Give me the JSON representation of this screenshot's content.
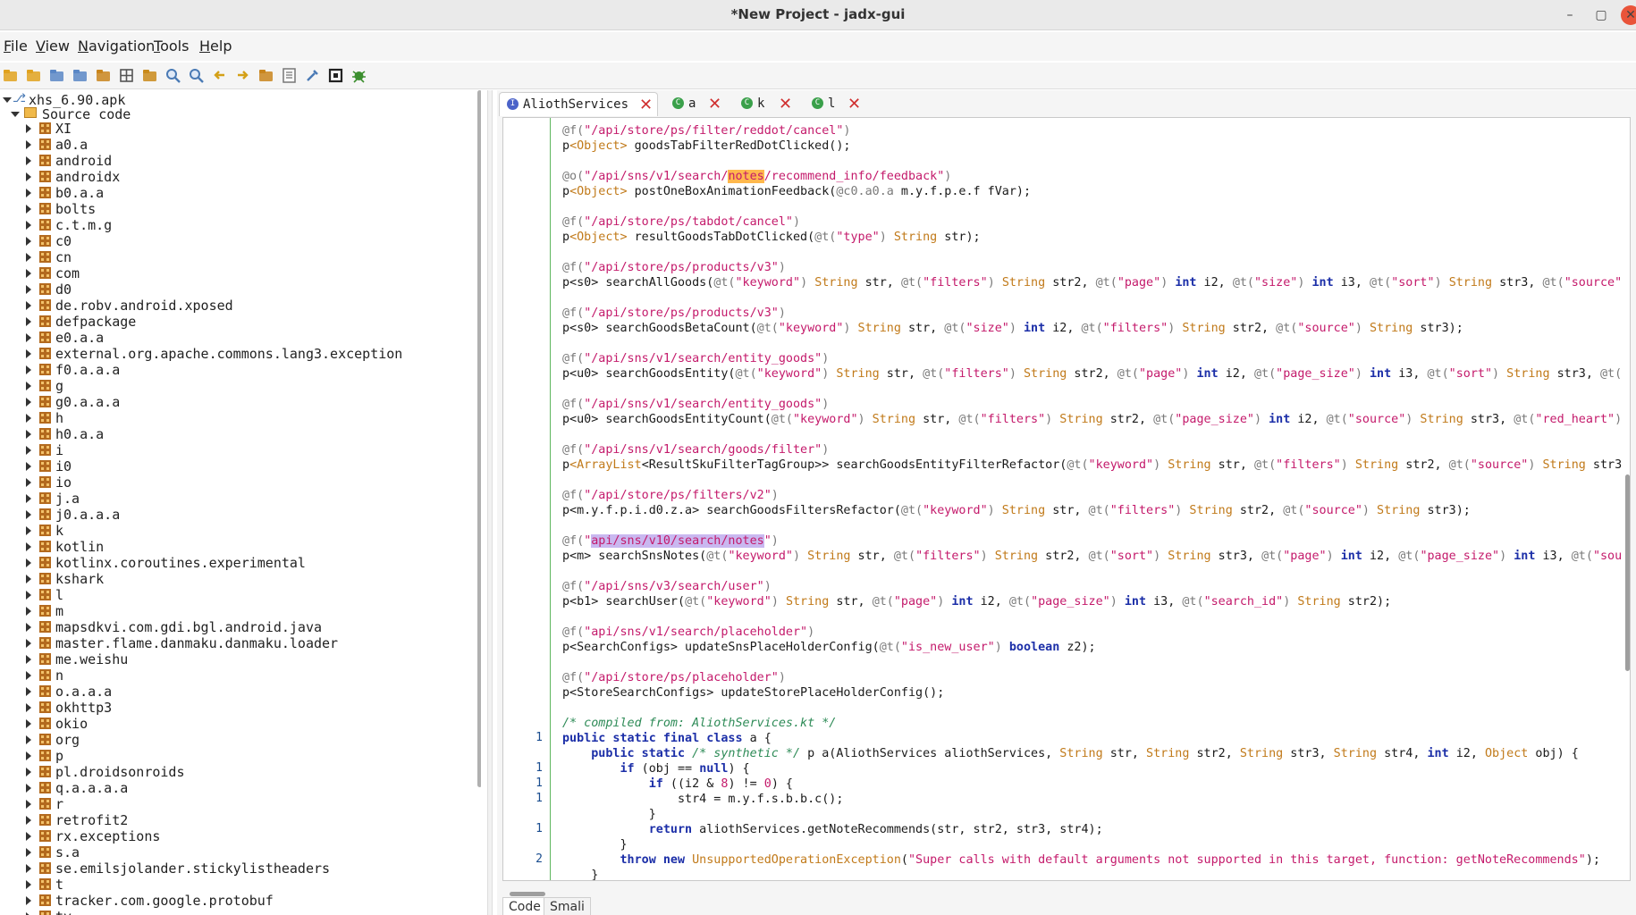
{
  "window": {
    "title": "*New Project - jadx-gui",
    "controls": [
      "–",
      "▢",
      "✕"
    ]
  },
  "menu": [
    {
      "label": "File",
      "mnemonic": "F",
      "rest": "ile"
    },
    {
      "label": "View",
      "mnemonic": "V",
      "rest": "iew"
    },
    {
      "label": "Navigation",
      "mnemonic": "N",
      "rest": "avigation"
    },
    {
      "label": "Tools",
      "mnemonic": "T",
      "rest": "ools"
    },
    {
      "label": "Help",
      "mnemonic": "H",
      "rest": "elp"
    }
  ],
  "toolbar": {
    "icons": [
      "open-file-icon",
      "add-files-icon",
      "save-all-icon",
      "export-icon",
      "sync-icon",
      "flatten-packages-icon",
      "decompile-icon",
      "search-icon",
      "search-class-icon",
      "back-icon",
      "forward-icon",
      "deobfuscation-icon",
      "log-viewer-icon",
      "preferences-icon",
      "quark-icon",
      "debug-icon"
    ]
  },
  "tree": {
    "root": "xhs_6.90.apk",
    "source_node": "Source code",
    "packages": [
      "XI",
      "a0.a",
      "android",
      "androidx",
      "b0.a.a",
      "bolts",
      "c.t.m.g",
      "c0",
      "cn",
      "com",
      "d0",
      "de.robv.android.xposed",
      "defpackage",
      "e0.a.a",
      "external.org.apache.commons.lang3.exception",
      "f0.a.a.a",
      "g",
      "g0.a.a.a",
      "h",
      "h0.a.a",
      "i",
      "i0",
      "io",
      "j.a",
      "j0.a.a.a",
      "k",
      "kotlin",
      "kotlinx.coroutines.experimental",
      "kshark",
      "l",
      "m",
      "mapsdkvi.com.gdi.bgl.android.java",
      "master.flame.danmaku.danmaku.loader",
      "me.weishu",
      "n",
      "o.a.a.a",
      "okhttp3",
      "okio",
      "org",
      "p",
      "pl.droidsonroids",
      "q.a.a.a.a",
      "r",
      "retrofit2",
      "rx.exceptions",
      "s.a",
      "se.emilsjolander.stickylistheaders",
      "t",
      "tracker.com.google.protobuf",
      "tv"
    ]
  },
  "tabs": [
    {
      "label": "AliothServices",
      "icon": "interface-icon",
      "active": true
    },
    {
      "label": "a",
      "icon": "class-icon",
      "active": false
    },
    {
      "label": "k",
      "icon": "class-icon",
      "active": false
    },
    {
      "label": "l",
      "icon": "class-icon",
      "active": false
    }
  ],
  "code_lines": [
    {
      "ln": "",
      "html": "<span class='ann'>@f(</span><span class='str'>\"/api/store/ps/filter/reddot/cancel\"</span><span class='ann'>)</span>"
    },
    {
      "ln": "",
      "html": "p<span class='typ'>&lt;Object&gt;</span> goodsTabFilterRedDotClicked();"
    },
    {
      "ln": "",
      "html": ""
    },
    {
      "ln": "",
      "html": "<span class='ann'>@o(</span><span class='str'>\"/api/sns/v1/search/<span class='hl-orange'>notes</span>/recommend_info/feedback\"</span><span class='ann'>)</span>"
    },
    {
      "ln": "",
      "html": "p<span class='typ'>&lt;Object&gt;</span> postOneBoxAnimationFeedback(<span class='ann'>@c0.a0.a</span> m.y.f.p.e.f fVar);"
    },
    {
      "ln": "",
      "html": ""
    },
    {
      "ln": "",
      "html": "<span class='ann'>@f(</span><span class='str'>\"/api/store/ps/tabdot/cancel\"</span><span class='ann'>)</span>"
    },
    {
      "ln": "",
      "html": "p<span class='typ'>&lt;Object&gt;</span> resultGoodsTabDotClicked(<span class='ann'>@t(</span><span class='str'>\"type\"</span><span class='ann'>)</span> <span class='typ'>String</span> str);"
    },
    {
      "ln": "",
      "html": ""
    },
    {
      "ln": "",
      "html": "<span class='ann'>@f(</span><span class='str'>\"/api/store/ps/products/v3\"</span><span class='ann'>)</span>"
    },
    {
      "ln": "",
      "html": "p&lt;s0&gt; searchAllGoods(<span class='ann'>@t(</span><span class='str'>\"keyword\"</span><span class='ann'>)</span> <span class='typ'>String</span> str, <span class='ann'>@t(</span><span class='str'>\"filters\"</span><span class='ann'>)</span> <span class='typ'>String</span> str2, <span class='ann'>@t(</span><span class='str'>\"page\"</span><span class='ann'>)</span> <span class='kw'>int</span> i2, <span class='ann'>@t(</span><span class='str'>\"size\"</span><span class='ann'>)</span> <span class='kw'>int</span> i3, <span class='ann'>@t(</span><span class='str'>\"sort\"</span><span class='ann'>)</span> <span class='typ'>String</span> str3, <span class='ann'>@t(</span><span class='str'>\"source\"</span>"
    },
    {
      "ln": "",
      "html": ""
    },
    {
      "ln": "",
      "html": "<span class='ann'>@f(</span><span class='str'>\"/api/store/ps/products/v3\"</span><span class='ann'>)</span>"
    },
    {
      "ln": "",
      "html": "p&lt;s0&gt; searchGoodsBetaCount(<span class='ann'>@t(</span><span class='str'>\"keyword\"</span><span class='ann'>)</span> <span class='typ'>String</span> str, <span class='ann'>@t(</span><span class='str'>\"size\"</span><span class='ann'>)</span> <span class='kw'>int</span> i2, <span class='ann'>@t(</span><span class='str'>\"filters\"</span><span class='ann'>)</span> <span class='typ'>String</span> str2, <span class='ann'>@t(</span><span class='str'>\"source\"</span><span class='ann'>)</span> <span class='typ'>String</span> str3);"
    },
    {
      "ln": "",
      "html": ""
    },
    {
      "ln": "",
      "html": "<span class='ann'>@f(</span><span class='str'>\"/api/sns/v1/search/entity_goods\"</span><span class='ann'>)</span>"
    },
    {
      "ln": "",
      "html": "p&lt;u0&gt; searchGoodsEntity(<span class='ann'>@t(</span><span class='str'>\"keyword\"</span><span class='ann'>)</span> <span class='typ'>String</span> str, <span class='ann'>@t(</span><span class='str'>\"filters\"</span><span class='ann'>)</span> <span class='typ'>String</span> str2, <span class='ann'>@t(</span><span class='str'>\"page\"</span><span class='ann'>)</span> <span class='kw'>int</span> i2, <span class='ann'>@t(</span><span class='str'>\"page_size\"</span><span class='ann'>)</span> <span class='kw'>int</span> i3, <span class='ann'>@t(</span><span class='str'>\"sort\"</span><span class='ann'>)</span> <span class='typ'>String</span> str3, <span class='ann'>@t(</span>"
    },
    {
      "ln": "",
      "html": ""
    },
    {
      "ln": "",
      "html": "<span class='ann'>@f(</span><span class='str'>\"/api/sns/v1/search/entity_goods\"</span><span class='ann'>)</span>"
    },
    {
      "ln": "",
      "html": "p&lt;u0&gt; searchGoodsEntityCount(<span class='ann'>@t(</span><span class='str'>\"keyword\"</span><span class='ann'>)</span> <span class='typ'>String</span> str, <span class='ann'>@t(</span><span class='str'>\"filters\"</span><span class='ann'>)</span> <span class='typ'>String</span> str2, <span class='ann'>@t(</span><span class='str'>\"page_size\"</span><span class='ann'>)</span> <span class='kw'>int</span> i2, <span class='ann'>@t(</span><span class='str'>\"source\"</span><span class='ann'>)</span> <span class='typ'>String</span> str3, <span class='ann'>@t(</span><span class='str'>\"red_heart\"</span><span class='ann'>)</span>"
    },
    {
      "ln": "",
      "html": ""
    },
    {
      "ln": "",
      "html": "<span class='ann'>@f(</span><span class='str'>\"/api/sns/v1/search/goods/filter\"</span><span class='ann'>)</span>"
    },
    {
      "ln": "",
      "html": "p<span class='typ'>&lt;ArrayList</span>&lt;ResultSkuFilterTagGroup&gt;&gt; searchGoodsEntityFilterRefactor(<span class='ann'>@t(</span><span class='str'>\"keyword\"</span><span class='ann'>)</span> <span class='typ'>String</span> str, <span class='ann'>@t(</span><span class='str'>\"filters\"</span><span class='ann'>)</span> <span class='typ'>String</span> str2, <span class='ann'>@t(</span><span class='str'>\"source\"</span><span class='ann'>)</span> <span class='typ'>String</span> str3"
    },
    {
      "ln": "",
      "html": ""
    },
    {
      "ln": "",
      "html": "<span class='ann'>@f(</span><span class='str'>\"/api/store/ps/filters/v2\"</span><span class='ann'>)</span>"
    },
    {
      "ln": "",
      "html": "p&lt;m.y.f.p.i.d0.z.a&gt; searchGoodsFiltersRefactor(<span class='ann'>@t(</span><span class='str'>\"keyword\"</span><span class='ann'>)</span> <span class='typ'>String</span> str, <span class='ann'>@t(</span><span class='str'>\"filters\"</span><span class='ann'>)</span> <span class='typ'>String</span> str2, <span class='ann'>@t(</span><span class='str'>\"source\"</span><span class='ann'>)</span> <span class='typ'>String</span> str3);"
    },
    {
      "ln": "",
      "html": ""
    },
    {
      "ln": "",
      "html": "<span class='ann'>@f(</span><span class='str'>\"<span class='hl-purple'>api/sns/v10/search/notes</span>\"</span><span class='ann'>)</span>"
    },
    {
      "ln": "",
      "html": "p&lt;m&gt; searchSnsNotes(<span class='ann'>@t(</span><span class='str'>\"keyword\"</span><span class='ann'>)</span> <span class='typ'>String</span> str, <span class='ann'>@t(</span><span class='str'>\"filters\"</span><span class='ann'>)</span> <span class='typ'>String</span> str2, <span class='ann'>@t(</span><span class='str'>\"sort\"</span><span class='ann'>)</span> <span class='typ'>String</span> str3, <span class='ann'>@t(</span><span class='str'>\"page\"</span><span class='ann'>)</span> <span class='kw'>int</span> i2, <span class='ann'>@t(</span><span class='str'>\"page_size\"</span><span class='ann'>)</span> <span class='kw'>int</span> i3, <span class='ann'>@t(</span><span class='str'>\"sou</span>"
    },
    {
      "ln": "",
      "html": ""
    },
    {
      "ln": "",
      "html": "<span class='ann'>@f(</span><span class='str'>\"/api/sns/v3/search/user\"</span><span class='ann'>)</span>"
    },
    {
      "ln": "",
      "html": "p&lt;b1&gt; searchUser(<span class='ann'>@t(</span><span class='str'>\"keyword\"</span><span class='ann'>)</span> <span class='typ'>String</span> str, <span class='ann'>@t(</span><span class='str'>\"page\"</span><span class='ann'>)</span> <span class='kw'>int</span> i2, <span class='ann'>@t(</span><span class='str'>\"page_size\"</span><span class='ann'>)</span> <span class='kw'>int</span> i3, <span class='ann'>@t(</span><span class='str'>\"search_id\"</span><span class='ann'>)</span> <span class='typ'>String</span> str2);"
    },
    {
      "ln": "",
      "html": ""
    },
    {
      "ln": "",
      "html": "<span class='ann'>@f(</span><span class='str'>\"api/sns/v1/search/placeholder\"</span><span class='ann'>)</span>"
    },
    {
      "ln": "",
      "html": "p&lt;SearchConfigs&gt; updateSnsPlaceHolderConfig(<span class='ann'>@t(</span><span class='str'>\"is_new_user\"</span><span class='ann'>)</span> <span class='kw'>boolean</span> z2);"
    },
    {
      "ln": "",
      "html": ""
    },
    {
      "ln": "",
      "html": "<span class='ann'>@f(</span><span class='str'>\"/api/store/ps/placeholder\"</span><span class='ann'>)</span>"
    },
    {
      "ln": "",
      "html": "p&lt;StoreSearchConfigs&gt; updateStorePlaceHolderConfig();"
    },
    {
      "ln": "",
      "html": ""
    },
    {
      "ln": "",
      "html": "<span class='cm'>/* compiled from: AliothServices.kt */</span>"
    },
    {
      "ln": "1",
      "html": "<span class='kw'>public static final class</span> a {"
    },
    {
      "ln": "",
      "html": "    <span class='kw'>public static</span> <span class='cm'>/* synthetic */</span> p a(AliothServices aliothServices, <span class='typ'>String</span> str, <span class='typ'>String</span> str2, <span class='typ'>String</span> str3, <span class='typ'>String</span> str4, <span class='kw'>int</span> i2, <span class='typ'>Object</span> obj) {"
    },
    {
      "ln": "1",
      "html": "        <span class='kw'>if</span> (obj == <span class='kw'>null</span>) {"
    },
    {
      "ln": "1",
      "html": "            <span class='kw'>if</span> ((i2 &amp; <span class='num'>8</span>) != <span class='num'>0</span>) {"
    },
    {
      "ln": "1",
      "html": "                str4 = m.y.f.s.b.b.c();"
    },
    {
      "ln": "",
      "html": "            }"
    },
    {
      "ln": "1",
      "html": "            <span class='kw'>return</span> aliothServices.getNoteRecommends(str, str2, str3, str4);"
    },
    {
      "ln": "",
      "html": "        }"
    },
    {
      "ln": "2",
      "html": "        <span class='kw'>throw new</span> <span class='typ'>UnsupportedOperationException</span>(<span class='str'>\"Super calls with default arguments not supported in this target, function: getNoteRecommends\"</span>);"
    },
    {
      "ln": "",
      "html": "    }"
    }
  ],
  "bottom_tabs": [
    "Code",
    "Smali"
  ]
}
